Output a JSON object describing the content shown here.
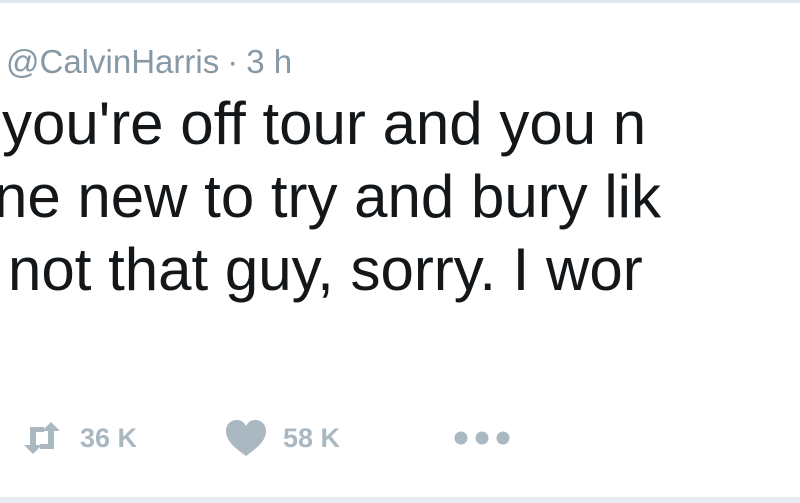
{
  "tweet": {
    "handle": "@CalvinHarris",
    "separator": "·",
    "time": "3 h",
    "text_lines": [
      "you're off tour and you n",
      "ne new to try and bury lik",
      "not that guy, sorry. I wor"
    ],
    "actions": {
      "retweet_count": "36 K",
      "like_count": "58 K"
    },
    "icons": {
      "retweet": "retweet-icon",
      "like": "heart-icon",
      "more": "more-dots-icon"
    },
    "colors": {
      "text": "#14171a",
      "muted": "#8899a6",
      "action": "#aab8c2"
    }
  }
}
